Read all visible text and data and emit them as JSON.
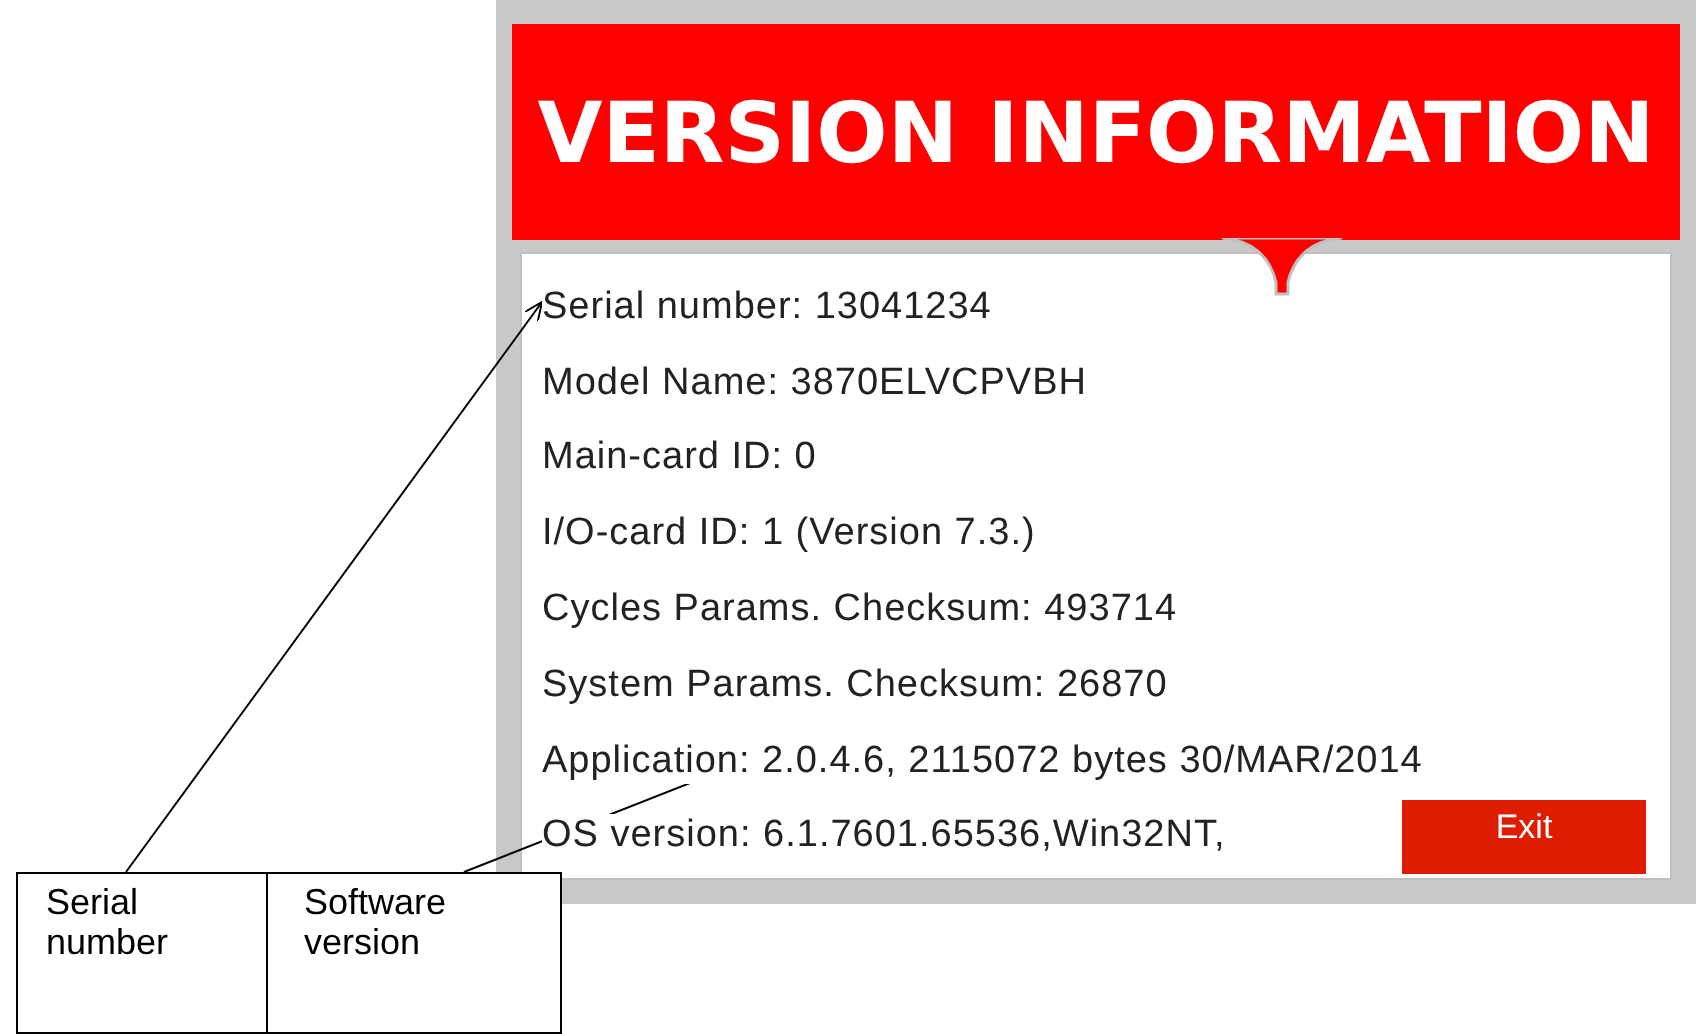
{
  "window": {
    "title": "VERSION INFORMATION"
  },
  "info_lines": [
    "Serial number: 13041234",
    "Model Name: 3870ELVCPVBH",
    "Main-card ID: 0",
    "I/O-card ID: 1 (Version 7.3.)",
    "Cycles Params. Checksum: 493714",
    "System Params. Checksum: 26870",
    "Application: 2.0.4.6, 2115072 bytes 30/MAR/2014",
    "OS version: 6.1.7601.65536,Win32NT,"
  ],
  "exit_button": {
    "label": "Exit"
  },
  "callouts": [
    "Serial number",
    "Software version"
  ]
}
